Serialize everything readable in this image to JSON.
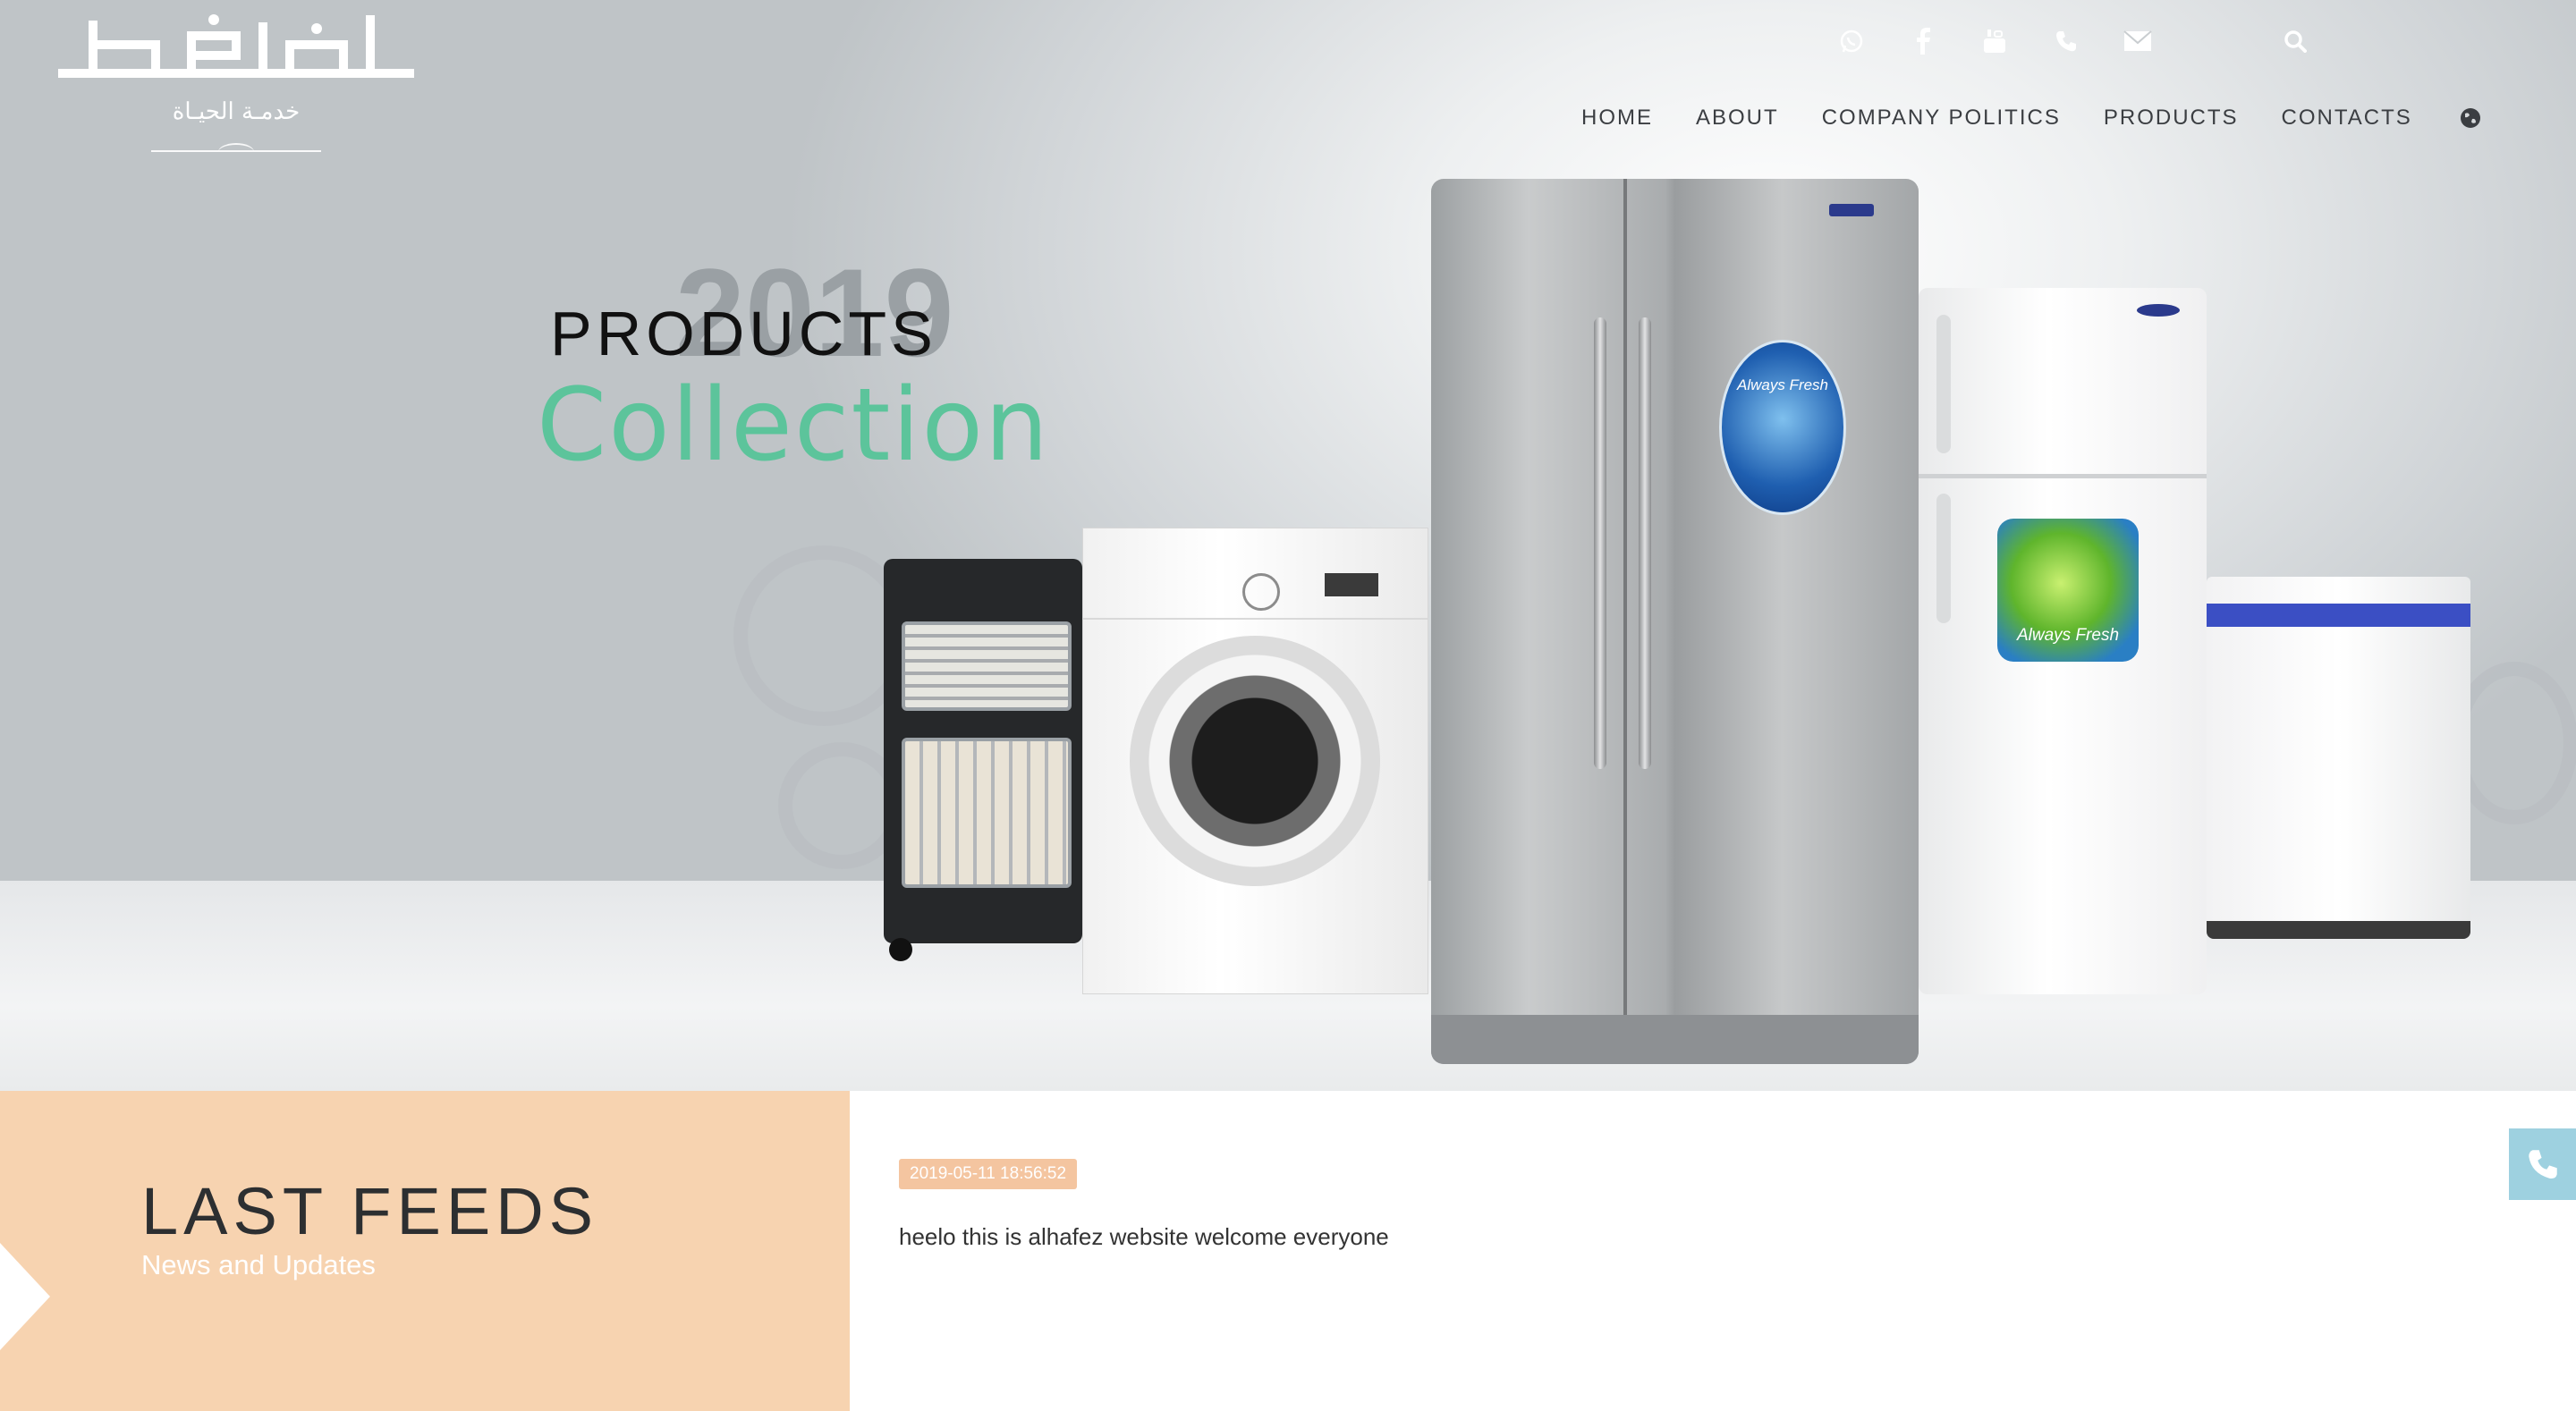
{
  "brand": {
    "tagline": "خدمـة الحيـاة"
  },
  "header": {
    "social_icons": [
      "whatsapp-icon",
      "facebook-icon",
      "youtube-icon",
      "phone-icon",
      "mail-icon"
    ],
    "search_icon": "search-icon",
    "nav": [
      "HOME",
      "ABOUT",
      "COMPANY POLITICS",
      "PRODUCTS",
      "CONTACTS"
    ],
    "language_icon": "globe-icon"
  },
  "hero": {
    "year": "2019",
    "products_label": "PRODUCTS",
    "collection_label": "Collection",
    "badge_text_1": "Always Fresh",
    "badge_text_2": "Always Fresh",
    "accent_color": "#5cc49b"
  },
  "feeds": {
    "title": "LAST FEEDS",
    "subtitle": "News and Updates",
    "items": [
      {
        "date": "2019-05-11 18:56:52",
        "text": "heelo this is alhafez website welcome everyone"
      }
    ],
    "panel_color": "#f7d3b0"
  },
  "floating": {
    "phone_icon": "phone-icon"
  }
}
